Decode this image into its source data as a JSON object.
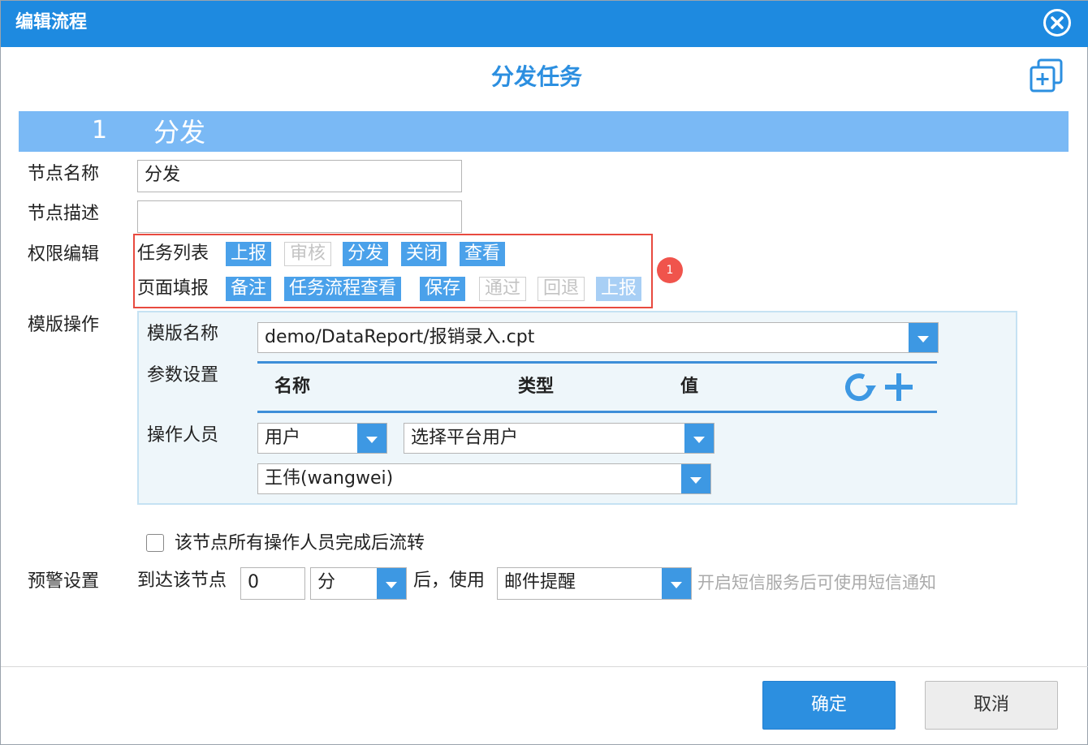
{
  "window": {
    "title": "编辑流程"
  },
  "page": {
    "heading": "分发任务"
  },
  "section": {
    "number": "1",
    "name": "分发"
  },
  "labels": {
    "node_name": "节点名称",
    "node_desc": "节点描述",
    "permission": "权限编辑",
    "template_op": "模版操作",
    "warning": "预警设置"
  },
  "fields": {
    "node_name_value": "分发",
    "node_desc_value": ""
  },
  "permissions": {
    "task_list": {
      "label": "任务列表",
      "tags": [
        {
          "text": "上报",
          "state": "on"
        },
        {
          "text": "审核",
          "state": "off"
        },
        {
          "text": "分发",
          "state": "on"
        },
        {
          "text": "关闭",
          "state": "on"
        },
        {
          "text": "查看",
          "state": "on"
        }
      ]
    },
    "page_fill": {
      "label": "页面填报",
      "tags": [
        {
          "text": "备注",
          "state": "on"
        },
        {
          "text": "任务流程查看",
          "state": "on"
        },
        {
          "text": "保存",
          "state": "on"
        },
        {
          "text": "通过",
          "state": "off"
        },
        {
          "text": "回退",
          "state": "off"
        },
        {
          "text": "上报",
          "state": "faint"
        }
      ]
    },
    "badge": "1"
  },
  "template": {
    "name_label": "模版名称",
    "name_value": "demo/DataReport/报销录入.cpt",
    "param_label": "参数设置",
    "param_columns": [
      "名称",
      "类型",
      "值"
    ],
    "operator_label": "操作人员",
    "operator_type": "用户",
    "operator_scope": "选择平台用户",
    "operator_user": "王伟(wangwei)"
  },
  "flow": {
    "checkbox_label": "该节点所有操作人员完成后流转",
    "checked": false
  },
  "warning": {
    "prefix": "到达该节点",
    "amount": "0",
    "unit": "分",
    "after": "后，使用",
    "method": "邮件提醒",
    "hint": "开启短信服务后可使用短信通知"
  },
  "buttons": {
    "confirm": "确定",
    "cancel": "取消"
  },
  "colors": {
    "accent": "#1e8ae0",
    "tag_active": "#4aa1ea",
    "highlight": "#e84a3f"
  }
}
